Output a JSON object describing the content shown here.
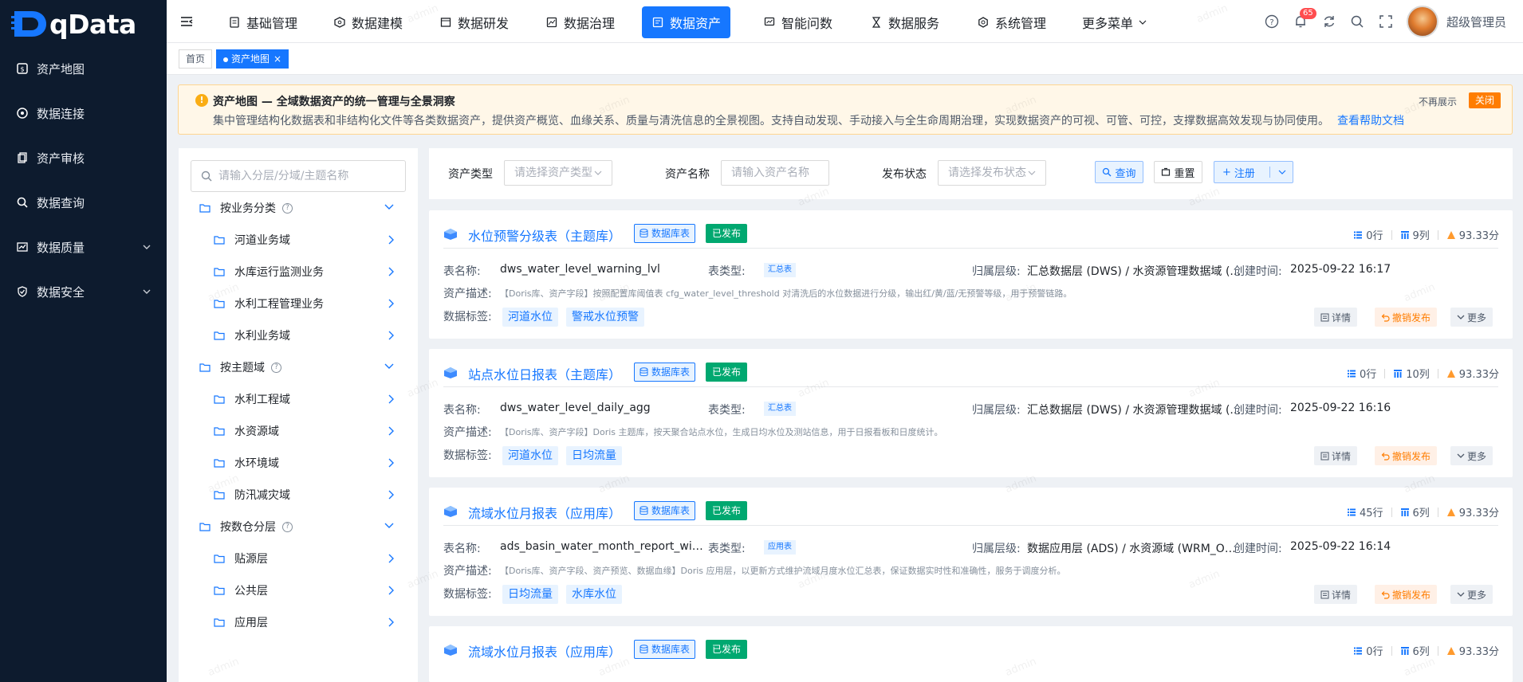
{
  "app": {
    "name": "qData"
  },
  "sidebar": {
    "items": [
      {
        "label": "资产地图",
        "icon": "asset-map-icon"
      },
      {
        "label": "数据连接",
        "icon": "connection-icon"
      },
      {
        "label": "资产审核",
        "icon": "audit-icon"
      },
      {
        "label": "数据查询",
        "icon": "search-icon"
      },
      {
        "label": "数据质量",
        "icon": "quality-icon",
        "expandable": true
      },
      {
        "label": "数据安全",
        "icon": "shield-icon",
        "expandable": true
      }
    ]
  },
  "topnav": {
    "items": [
      {
        "label": "基础管理"
      },
      {
        "label": "数据建模"
      },
      {
        "label": "数据研发"
      },
      {
        "label": "数据治理"
      },
      {
        "label": "数据资产",
        "active": true
      },
      {
        "label": "智能问数"
      },
      {
        "label": "数据服务"
      },
      {
        "label": "系统管理"
      },
      {
        "label": "更多菜单"
      }
    ],
    "notification_count": "65",
    "username": "超级管理员"
  },
  "tabs": [
    {
      "label": "首页"
    },
    {
      "label": "资产地图",
      "active": true
    }
  ],
  "notice": {
    "title": "资产地图 — 全域数据资产的统一管理与全景洞察",
    "description": "集中管理结构化数据表和非结构化文件等各类数据资产，提供资产概览、血缘关系、质量与清洗信息的全景视图。支持自动发现、手动接入与全生命周期治理，实现数据资产的可视、可管、可控，支撑数据高效发现与协同使用。",
    "link": "查看帮助文档",
    "hide_label": "不再展示",
    "close_label": "关闭"
  },
  "tree": {
    "search_placeholder": "请输入分层/分域/主题名称",
    "groups": [
      {
        "label": "按业务分类",
        "children": [
          "河道业务域",
          "水库运行监测业务",
          "水利工程管理业务",
          "水利业务域"
        ]
      },
      {
        "label": "按主题域",
        "children": [
          "水利工程域",
          "水资源域",
          "水环境域",
          "防汛减灾域"
        ]
      },
      {
        "label": "按数仓分层",
        "children": [
          "贴源层",
          "公共层",
          "应用层"
        ]
      }
    ]
  },
  "filters": {
    "asset_type_label": "资产类型",
    "asset_type_placeholder": "请选择资产类型",
    "asset_name_label": "资产名称",
    "asset_name_placeholder": "请输入资产名称",
    "publish_label": "发布状态",
    "publish_placeholder": "请选择发布状态",
    "query_btn": "查询",
    "reset_btn": "重置",
    "register_btn": "注册"
  },
  "card_labels": {
    "table_name": "表名称:",
    "table_type": "表类型:",
    "layer": "归属层级:",
    "created": "创建时间:",
    "desc": "资产描述:",
    "tags": "数据标签:",
    "detail": "详情",
    "revoke": "撤销发布",
    "more": "更多"
  },
  "cards": [
    {
      "title": "水位预警分级表（主题库）",
      "type_badge": "数据库表",
      "status": "已发布",
      "rows": "0行",
      "cols": "9列",
      "score": "93.33分",
      "table_name": "dws_water_level_warning_lvl",
      "table_type": "汇总表",
      "layer": "汇总数据层 (DWS) / 水资源管理数据域 (...",
      "created": "2025-09-22 16:17",
      "desc": "【Doris库、资产字段】按照配置库阈值表 cfg_water_level_threshold 对清洗后的水位数据进行分级，输出红/黄/蓝/无预警等级，用于预警链路。",
      "tags": [
        "河道水位",
        "警戒水位预警"
      ]
    },
    {
      "title": "站点水位日报表（主题库）",
      "type_badge": "数据库表",
      "status": "已发布",
      "rows": "0行",
      "cols": "10列",
      "score": "93.33分",
      "table_name": "dws_water_level_daily_agg",
      "table_type": "汇总表",
      "layer": "汇总数据层 (DWS) / 水资源管理数据域 (...",
      "created": "2025-09-22 16:16",
      "desc": "【Doris库、资产字段】Doris 主题库，按天聚合站点水位，生成日均水位及测站信息，用于日报看板和日度统计。",
      "tags": [
        "河道水位",
        "日均流量"
      ]
    },
    {
      "title": "流域水位月报表（应用库）",
      "type_badge": "数据库表",
      "status": "已发布",
      "rows": "45行",
      "cols": "6列",
      "score": "93.33分",
      "table_name": "ads_basin_water_month_report_wide_...",
      "table_type": "应用表",
      "layer": "数据应用层 (ADS) / 水资源域 (WRM_ODL)",
      "created": "2025-09-22 16:14",
      "desc": "【Doris库、资产字段、资产预览、数据血缘】Doris 应用层，以更新方式维护流域月度水位汇总表，保证数据实时性和准确性，服务于调度分析。",
      "tags": [
        "日均流量",
        "水库水位"
      ]
    },
    {
      "title": "流域水位月报表（应用库）",
      "type_badge": "数据库表",
      "status": "已发布",
      "rows": "0行",
      "cols": "6列",
      "score": "93.33分"
    }
  ],
  "watermark": "admin",
  "colors": {
    "primary": "#1677ff",
    "sidebar": "#0d1b2e",
    "success": "#00a870",
    "warning": "#ff7d00"
  }
}
